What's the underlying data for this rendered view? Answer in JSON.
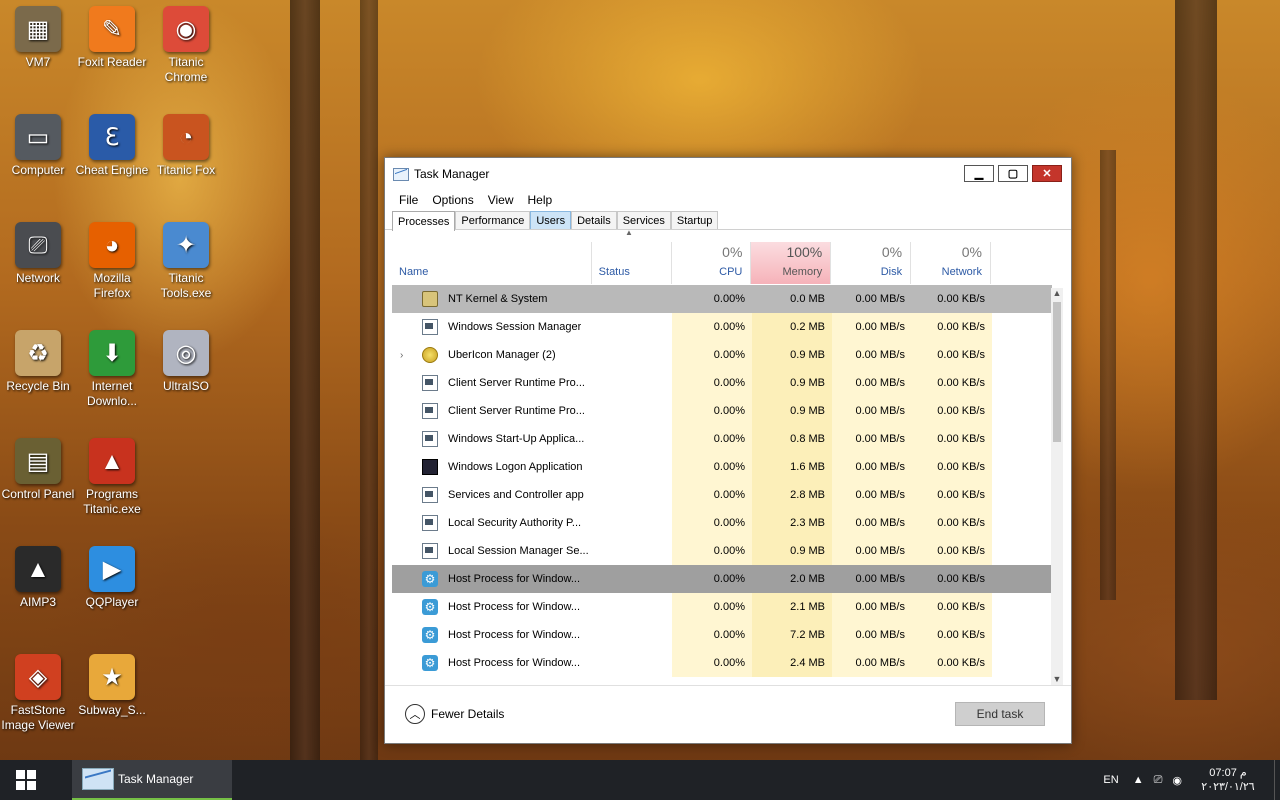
{
  "desktop_icons": [
    {
      "label": "VM7",
      "icon": "vm-icon",
      "color": "#7b6a4b"
    },
    {
      "label": "Foxit Reader",
      "icon": "pdf-icon",
      "color": "#f07a1d"
    },
    {
      "label": "Titanic Chrome",
      "icon": "chrome-icon",
      "color": "#dd4b39"
    },
    {
      "label": "Computer",
      "icon": "computer-icon",
      "color": "#555a60"
    },
    {
      "label": "Cheat Engine",
      "icon": "cheat-engine-icon",
      "color": "#2a5ba8"
    },
    {
      "label": "Titanic Fox",
      "icon": "titanic-fox-icon",
      "color": "#c9541f"
    },
    {
      "label": "Network",
      "icon": "network-icon",
      "color": "#4a4c50"
    },
    {
      "label": "Mozilla Firefox",
      "icon": "firefox-icon",
      "color": "#e66000"
    },
    {
      "label": "Titanic Tools.exe",
      "icon": "tools-icon",
      "color": "#4a8ad0"
    },
    {
      "label": "Recycle Bin",
      "icon": "recycle-bin-icon",
      "color": "#c7a46a"
    },
    {
      "label": "Internet Downlo...",
      "icon": "download-icon",
      "color": "#2e9b3a"
    },
    {
      "label": "UltraISO",
      "icon": "disc-icon",
      "color": "#b0b4c0"
    },
    {
      "label": "Control Panel",
      "icon": "control-panel-icon",
      "color": "#6a6033"
    },
    {
      "label": "Programs Titanic.exe",
      "icon": "programs-icon",
      "color": "#c8321e"
    },
    {
      "label": "AIMP3",
      "icon": "aimp-icon",
      "color": "#2a2a2a"
    },
    {
      "label": "QQPlayer",
      "icon": "qqplayer-icon",
      "color": "#2d8ee0"
    },
    {
      "label": "FastStone Image Viewer",
      "icon": "eye-icon",
      "color": "#d04020"
    },
    {
      "label": "Subway_S...",
      "icon": "subway-icon",
      "color": "#e8a83a"
    }
  ],
  "window": {
    "title": "Task Manager",
    "min": "▁",
    "max": "▢",
    "close": "✕"
  },
  "menu": [
    "File",
    "Options",
    "View",
    "Help"
  ],
  "tabs": [
    "Processes",
    "Performance",
    "Users",
    "Details",
    "Services",
    "Startup"
  ],
  "columns": {
    "name": "Name",
    "status": "Status",
    "cpu": {
      "pct": "0%",
      "label": "CPU"
    },
    "memory": {
      "pct": "100%",
      "label": "Memory"
    },
    "disk": {
      "pct": "0%",
      "label": "Disk"
    },
    "network": {
      "pct": "0%",
      "label": "Network"
    }
  },
  "processes": [
    {
      "name": "NT Kernel & System",
      "icon": "kernel",
      "cpu": "0.00%",
      "mem": "0.0 MB",
      "disk": "0.00 MB/s",
      "net": "0.00 KB/s",
      "state": "sel"
    },
    {
      "name": "Windows Session Manager",
      "icon": "win",
      "cpu": "0.00%",
      "mem": "0.2 MB",
      "disk": "0.00 MB/s",
      "net": "0.00 KB/s",
      "state": ""
    },
    {
      "name": "UberIcon Manager (2)",
      "icon": "uber",
      "cpu": "0.00%",
      "mem": "0.9 MB",
      "disk": "0.00 MB/s",
      "net": "0.00 KB/s",
      "state": "",
      "expand": "›"
    },
    {
      "name": "Client Server Runtime Pro...",
      "icon": "win",
      "cpu": "0.00%",
      "mem": "0.9 MB",
      "disk": "0.00 MB/s",
      "net": "0.00 KB/s",
      "state": ""
    },
    {
      "name": "Client Server Runtime Pro...",
      "icon": "win",
      "cpu": "0.00%",
      "mem": "0.9 MB",
      "disk": "0.00 MB/s",
      "net": "0.00 KB/s",
      "state": ""
    },
    {
      "name": "Windows Start-Up Applica...",
      "icon": "win",
      "cpu": "0.00%",
      "mem": "0.8 MB",
      "disk": "0.00 MB/s",
      "net": "0.00 KB/s",
      "state": ""
    },
    {
      "name": "Windows Logon Application",
      "icon": "logon",
      "cpu": "0.00%",
      "mem": "1.6 MB",
      "disk": "0.00 MB/s",
      "net": "0.00 KB/s",
      "state": ""
    },
    {
      "name": "Services and Controller app",
      "icon": "win",
      "cpu": "0.00%",
      "mem": "2.8 MB",
      "disk": "0.00 MB/s",
      "net": "0.00 KB/s",
      "state": ""
    },
    {
      "name": "Local Security Authority P...",
      "icon": "win",
      "cpu": "0.00%",
      "mem": "2.3 MB",
      "disk": "0.00 MB/s",
      "net": "0.00 KB/s",
      "state": ""
    },
    {
      "name": "Local Session Manager Se...",
      "icon": "win",
      "cpu": "0.00%",
      "mem": "0.9 MB",
      "disk": "0.00 MB/s",
      "net": "0.00 KB/s",
      "state": ""
    },
    {
      "name": "Host Process for Window...",
      "icon": "gear",
      "cpu": "0.00%",
      "mem": "2.0 MB",
      "disk": "0.00 MB/s",
      "net": "0.00 KB/s",
      "state": "sel2"
    },
    {
      "name": "Host Process for Window...",
      "icon": "gear",
      "cpu": "0.00%",
      "mem": "2.1 MB",
      "disk": "0.00 MB/s",
      "net": "0.00 KB/s",
      "state": ""
    },
    {
      "name": "Host Process for Window...",
      "icon": "gear",
      "cpu": "0.00%",
      "mem": "7.2 MB",
      "disk": "0.00 MB/s",
      "net": "0.00 KB/s",
      "state": ""
    },
    {
      "name": "Host Process for Window...",
      "icon": "gear",
      "cpu": "0.00%",
      "mem": "2.4 MB",
      "disk": "0.00 MB/s",
      "net": "0.00 KB/s",
      "state": ""
    }
  ],
  "footer": {
    "fewer_details": "Fewer Details",
    "end_task": "End task"
  },
  "taskbar": {
    "app_label": "Task Manager",
    "lang": "EN",
    "time": "07:07 م",
    "date": "٢٠٢٣/٠١/٢٦"
  }
}
